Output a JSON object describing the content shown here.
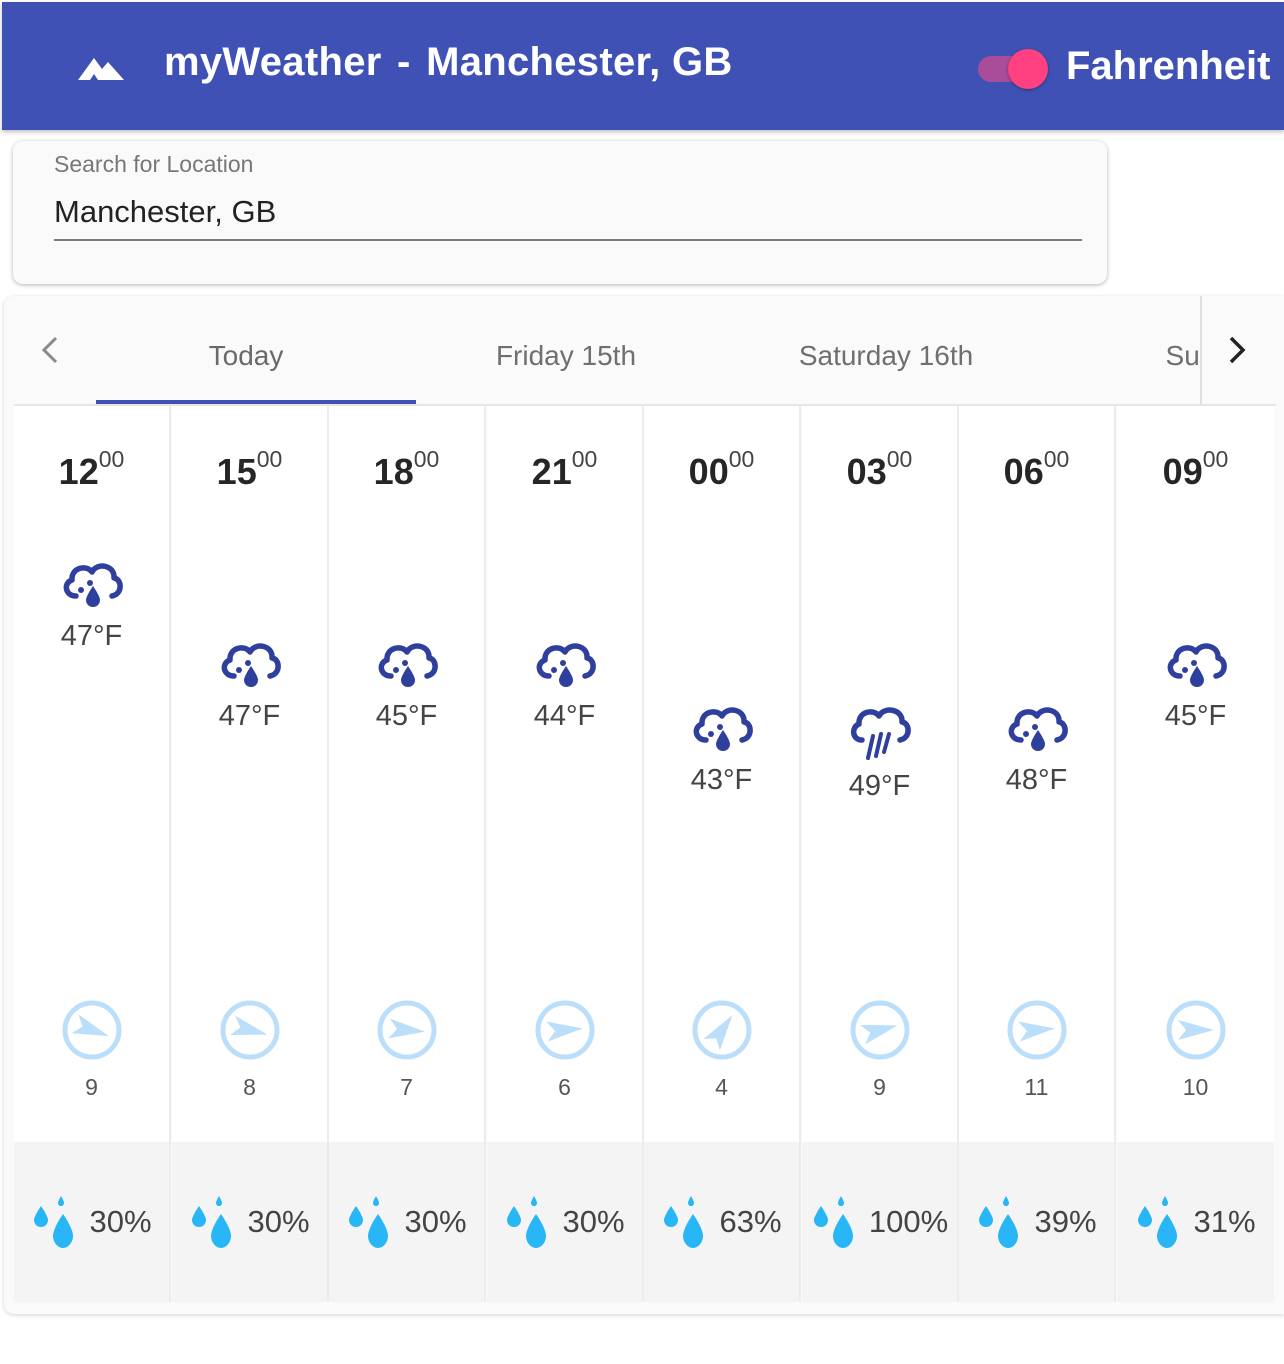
{
  "app": {
    "name": "myWeather",
    "separator": "-",
    "location": "Manchester, GB",
    "logo_icon": "mountain-icon"
  },
  "units": {
    "label": "Fahrenheit",
    "enabled": true
  },
  "search": {
    "label": "Search for Location",
    "value": "Manchester, GB"
  },
  "days": {
    "tabs": [
      "Today",
      "Friday 15th",
      "Saturday 16th",
      "Sunda"
    ],
    "active": 0
  },
  "hours": [
    {
      "hour": "12",
      "min": "00",
      "icon": "rain-cloud-icon",
      "temp": "47°F",
      "wind_speed": "9",
      "wind_direction_deg": 110,
      "precip": "30%"
    },
    {
      "hour": "15",
      "min": "00",
      "icon": "rain-cloud-icon",
      "temp": "47°F",
      "wind_speed": "8",
      "wind_direction_deg": 105,
      "precip": "30%"
    },
    {
      "hour": "18",
      "min": "00",
      "icon": "rain-cloud-icon",
      "temp": "45°F",
      "wind_speed": "7",
      "wind_direction_deg": 95,
      "precip": "30%"
    },
    {
      "hour": "21",
      "min": "00",
      "icon": "rain-cloud-icon",
      "temp": "44°F",
      "wind_speed": "6",
      "wind_direction_deg": 85,
      "precip": "30%"
    },
    {
      "hour": "00",
      "min": "00",
      "icon": "rain-cloud-icon",
      "temp": "43°F",
      "wind_speed": "4",
      "wind_direction_deg": 35,
      "precip": "63%"
    },
    {
      "hour": "03",
      "min": "00",
      "icon": "heavy-rain-icon",
      "temp": "49°F",
      "wind_speed": "9",
      "wind_direction_deg": 75,
      "precip": "100%"
    },
    {
      "hour": "06",
      "min": "00",
      "icon": "rain-cloud-icon",
      "temp": "48°F",
      "wind_speed": "11",
      "wind_direction_deg": 85,
      "precip": "39%"
    },
    {
      "hour": "09",
      "min": "00",
      "icon": "rain-cloud-icon",
      "temp": "45°F",
      "wind_speed": "10",
      "wind_direction_deg": 90,
      "precip": "31%"
    }
  ],
  "colors": {
    "primary": "#3f51b5",
    "accent": "#ff4081",
    "icon": "#2f3f9e",
    "wind": "#bbdefb",
    "precip": "#29b6f6"
  }
}
